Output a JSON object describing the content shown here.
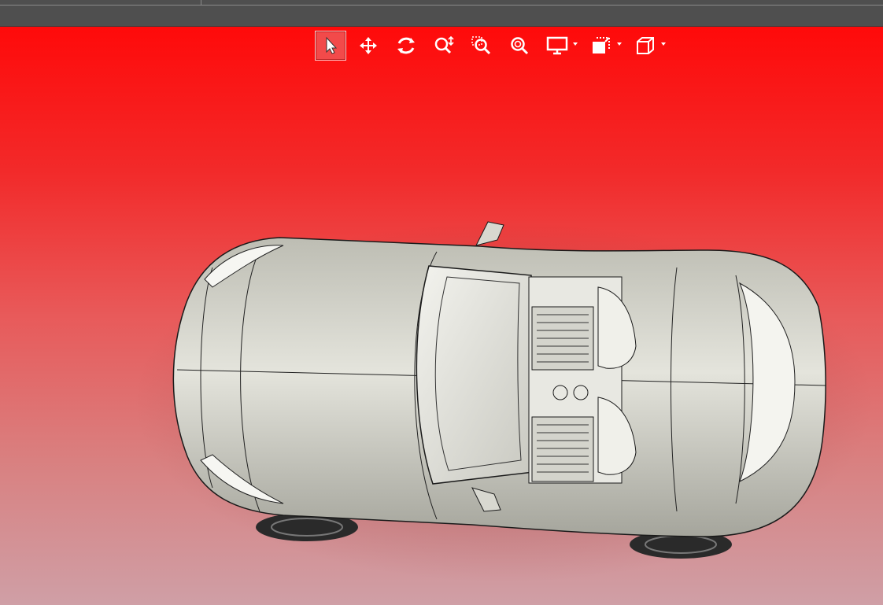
{
  "window": {
    "background_top": "#ff0a0a",
    "background_bottom": "#cf9fa6",
    "chrome": "#4f4f4f"
  },
  "toolbar": {
    "items": [
      {
        "icon": "select-arrow-icon",
        "active": true
      },
      {
        "icon": "pan-move-icon"
      },
      {
        "icon": "rotate-icon"
      },
      {
        "icon": "zoom-in-out-icon"
      },
      {
        "icon": "zoom-area-icon"
      },
      {
        "icon": "zoom-fit-icon"
      },
      {
        "icon": "display-mode-icon",
        "dropdown": true
      },
      {
        "icon": "view-orientation-icon",
        "dropdown": true
      },
      {
        "icon": "standard-views-cube-icon",
        "dropdown": true
      }
    ],
    "icon_color": "#ffffff",
    "active_color": "#f24a4a"
  },
  "model": {
    "name_icon": "sports-car-model",
    "body_color": "#cfcfc6",
    "tire_color": "#2a2a2a"
  }
}
